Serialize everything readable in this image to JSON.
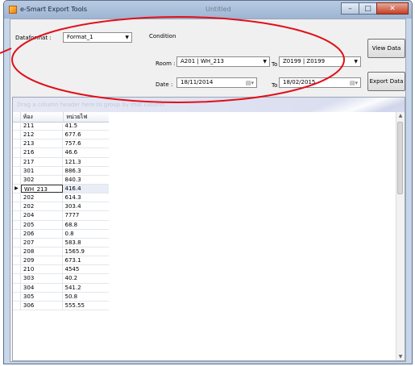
{
  "window": {
    "title": "e-Smart Export Tools",
    "title_center": "Untitled",
    "controls": {
      "minimize": "–",
      "maximize": "□",
      "close": "✕"
    }
  },
  "filters": {
    "dataformat_label": "Dataformat :",
    "dataformat_value": "Format_1",
    "condition_label": "Condition",
    "room_label": "Room :",
    "room_from": "A201   |   WH_213",
    "to_label": "To :",
    "room_to": "Z0199   |   Z0199",
    "date_label": "Date :",
    "date_from": "18/11/2014",
    "date_to_label": "To :",
    "date_to": "18/02/2015"
  },
  "buttons": {
    "view": "View Data",
    "export": "Export Data"
  },
  "grid": {
    "group_panel_text": "Drag a column header here to group by that column",
    "columns": [
      "ห้อง",
      "หน่วยไฟ"
    ],
    "current_row_marker": "▶",
    "rows": [
      [
        "211",
        "41.5"
      ],
      [
        "212",
        "677.6"
      ],
      [
        "213",
        "757.6"
      ],
      [
        "216",
        "46.6"
      ],
      [
        "217",
        "121.3"
      ],
      [
        "301",
        "886.3"
      ],
      [
        "302",
        "840.3"
      ],
      [
        "WH_213",
        "416.4"
      ],
      [
        "202",
        "614.3"
      ],
      [
        "202",
        "303.4"
      ],
      [
        "204",
        "7777"
      ],
      [
        "205",
        "68.8"
      ],
      [
        "206",
        "0.8"
      ],
      [
        "207",
        "583.8"
      ],
      [
        "208",
        "1565.9"
      ],
      [
        "209",
        "673.1"
      ],
      [
        "210",
        "4545"
      ],
      [
        "303",
        "40.2"
      ],
      [
        "304",
        "541.2"
      ],
      [
        "305",
        "50.8"
      ],
      [
        "306",
        "555.55"
      ]
    ]
  },
  "colors": {
    "annotation": "#e0101a",
    "titlebar": "#a9bfdc",
    "selected_row": "#e8edf6"
  }
}
